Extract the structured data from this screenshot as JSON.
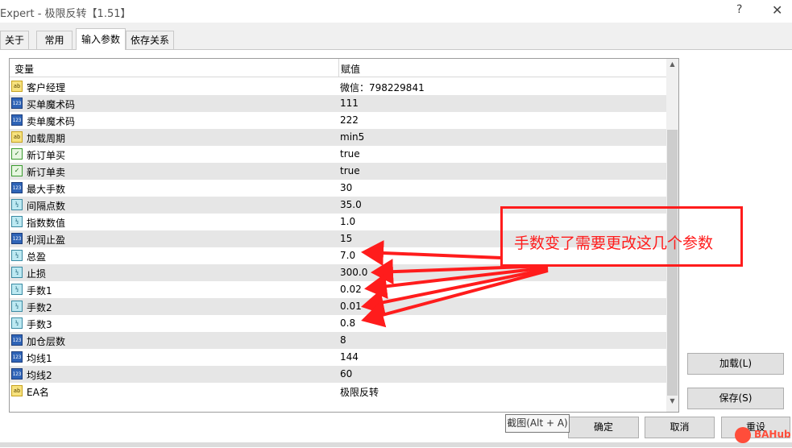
{
  "window": {
    "title": "Expert - 极限反转【1.51】",
    "help_glyph": "?",
    "close_glyph": "✕"
  },
  "tabs": [
    {
      "label": "关于"
    },
    {
      "label": "常用"
    },
    {
      "label": "输入参数",
      "active": true
    },
    {
      "label": "依存关系"
    }
  ],
  "grid": {
    "columns": [
      "变量",
      "赋值"
    ],
    "rows": [
      {
        "type": "ab",
        "icon_text": "ab",
        "name": "客户经理",
        "value": "微信：798229841"
      },
      {
        "type": "n123",
        "icon_text": "123",
        "name": "买单魔术码",
        "value": "111"
      },
      {
        "type": "n123",
        "icon_text": "123",
        "name": "卖单魔术码",
        "value": "222"
      },
      {
        "type": "ab",
        "icon_text": "ab",
        "name": "加载周期",
        "value": "min5"
      },
      {
        "type": "bool",
        "icon_text": "✓",
        "name": "新订单买",
        "value": "true"
      },
      {
        "type": "bool",
        "icon_text": "✓",
        "name": "新订单卖",
        "value": "true"
      },
      {
        "type": "n123",
        "icon_text": "123",
        "name": "最大手数",
        "value": "30"
      },
      {
        "type": "dbl",
        "icon_text": "½",
        "name": "间隔点数",
        "value": "35.0"
      },
      {
        "type": "dbl",
        "icon_text": "½",
        "name": "指数数值",
        "value": "1.0"
      },
      {
        "type": "n123",
        "icon_text": "123",
        "name": "利润止盈",
        "value": "15"
      },
      {
        "type": "dbl",
        "icon_text": "½",
        "name": "总盈",
        "value": "7.0"
      },
      {
        "type": "dbl",
        "icon_text": "½",
        "name": "止损",
        "value": "300.0"
      },
      {
        "type": "dbl",
        "icon_text": "½",
        "name": "手数1",
        "value": "0.02"
      },
      {
        "type": "dbl",
        "icon_text": "½",
        "name": "手数2",
        "value": "0.01"
      },
      {
        "type": "dbl",
        "icon_text": "½",
        "name": "手数3",
        "value": "0.8"
      },
      {
        "type": "n123",
        "icon_text": "123",
        "name": "加仓层数",
        "value": "8"
      },
      {
        "type": "n123",
        "icon_text": "123",
        "name": "均线1",
        "value": "144"
      },
      {
        "type": "n123",
        "icon_text": "123",
        "name": "均线2",
        "value": "60"
      },
      {
        "type": "ab",
        "icon_text": "ab",
        "name": "EA名",
        "value": "极限反转"
      }
    ]
  },
  "side_buttons": {
    "load": "加载(L)",
    "save": "保存(S)"
  },
  "bottom_buttons": {
    "ok": "确定",
    "cancel": "取消",
    "reset": "重设"
  },
  "tooltip": "截图(Alt + A)",
  "annotation": {
    "text": "手数变了需要更改这几个参数",
    "color": "#ff1c1c"
  },
  "watermark": {
    "text": "BAHub"
  },
  "scrollbar": {
    "up": "▲",
    "down": "▼"
  }
}
